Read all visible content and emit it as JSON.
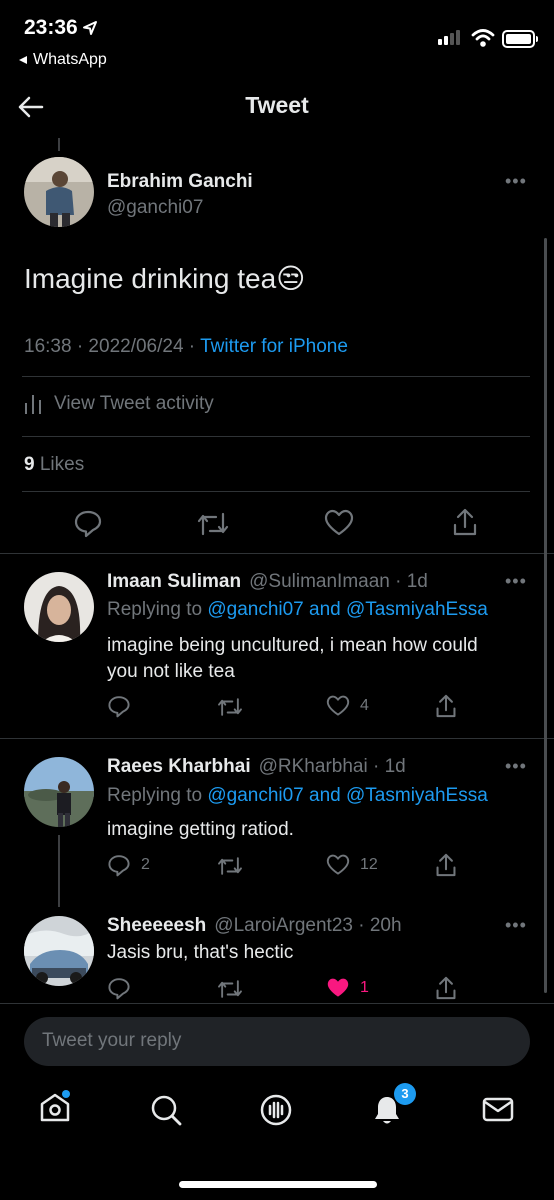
{
  "status_bar": {
    "time": "23:36",
    "back_label": "WhatsApp"
  },
  "header": {
    "title": "Tweet"
  },
  "tweet": {
    "author_name": "Ebrahim Ganchi",
    "author_handle": "@ganchi07",
    "text": "Imagine drinking tea😒",
    "time": "16:38 · 2022/06/24 · ",
    "source": "Twitter for iPhone",
    "activity_label": "View Tweet activity",
    "likes_count": "9",
    "likes_label": " Likes"
  },
  "replies": [
    {
      "name": "Imaan Suliman",
      "handle": "@SulimanImaan · 1d",
      "replying_prefix": "Replying to ",
      "replying_links": "@ganchi07 and @TasmiyahEssa",
      "text_line1": "imagine being uncultured, i mean how could",
      "text_line2": "you not like tea",
      "reply_count": "",
      "retweet_count": "",
      "like_count": "4"
    },
    {
      "name": "Raees Kharbhai",
      "handle": "@RKharbhai · 1d",
      "replying_prefix": "Replying to ",
      "replying_links": "@ganchi07 and @TasmiyahEssa",
      "text_line1": "imagine getting ratiod.",
      "reply_count": "2",
      "retweet_count": "",
      "like_count": "12"
    },
    {
      "name": "Sheeeeesh",
      "handle": "@LaroiArgent23 · 20h",
      "text_line1": "Jasis bru, that's hectic",
      "reply_count": "",
      "retweet_count": "",
      "like_count": "1",
      "liked": true
    }
  ],
  "reply_input": {
    "placeholder": "Tweet your reply"
  },
  "tab_bar": {
    "notifications_badge": "3"
  },
  "colors": {
    "accent": "#1d9bf0",
    "like_pink": "#f91880",
    "muted": "#71767b",
    "background": "#000000"
  }
}
